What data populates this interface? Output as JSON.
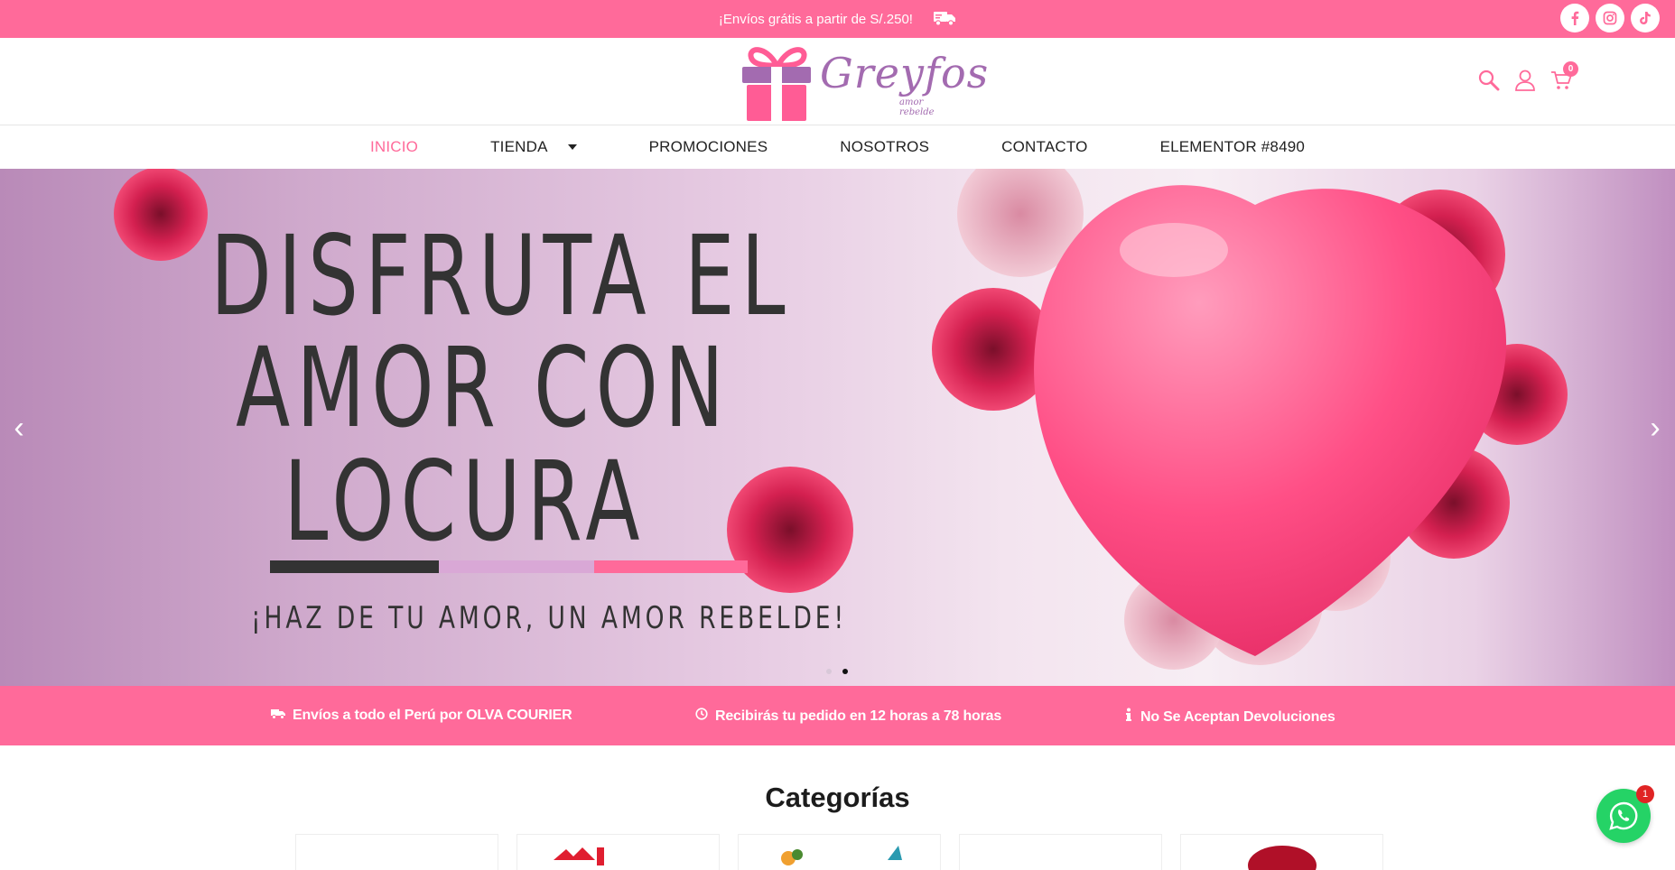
{
  "topbar": {
    "promo_text": "¡Envíos grátis a partir de S/.250!",
    "social": [
      {
        "icon": "facebook-icon",
        "label": "f"
      },
      {
        "icon": "instagram-icon"
      },
      {
        "icon": "tiktok-icon"
      }
    ],
    "bg_color": "#ff6a9a"
  },
  "header": {
    "logo_text": "Greyfos",
    "logo_subtext": "amor rebelde",
    "cart_count": "0"
  },
  "nav": {
    "items": [
      {
        "label": "INICIO",
        "active": true
      },
      {
        "label": "TIENDA",
        "has_dropdown": true
      },
      {
        "label": "PROMOCIONES"
      },
      {
        "label": "NOSOTROS"
      },
      {
        "label": "CONTACTO"
      },
      {
        "label": "ELEMENTOR #8490"
      }
    ]
  },
  "hero": {
    "line1": "DISFRUTA EL",
    "line2": "AMOR CON",
    "line3": "LOCURA",
    "tagline": "¡HAZ DE TU AMOR, UN AMOR REBELDE!",
    "slide_count": 2,
    "active_slide": 2
  },
  "features": [
    {
      "icon": "truck-icon",
      "text": "Envíos a todo el Perú por OLVA COURIER"
    },
    {
      "icon": "clock-icon",
      "text": "Recibirás tu pedido en 12 horas a 78 horas"
    },
    {
      "icon": "info-icon",
      "text": "No Se Aceptan Devoluciones"
    }
  ],
  "categories": {
    "title": "Categorías"
  },
  "whatsapp": {
    "badge": "1"
  }
}
